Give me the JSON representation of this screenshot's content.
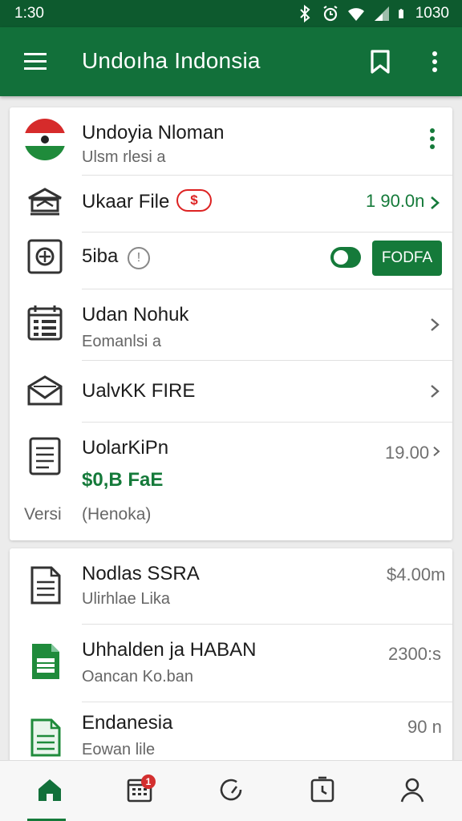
{
  "status_bar": {
    "time": "1:30",
    "clock": "1030"
  },
  "app_bar": {
    "title": "Undoıha Indonsia"
  },
  "card1": {
    "profile": {
      "title": "Undoyia Nloman",
      "subtitle": "Ulsm rlesi a"
    },
    "row_file": {
      "label": "Ukaar File",
      "badge": "$",
      "value": "1 90.0n"
    },
    "row_toggle": {
      "label": "5iba",
      "info": "!",
      "button": "FODFA"
    },
    "row_calendar": {
      "title": "Udan Nohuk",
      "subtitle": "Eomanlsi a"
    },
    "row_mail": {
      "label": "UalvKK FIRE"
    },
    "row_doc": {
      "title": "UolarKiPn",
      "amount": "$0,B FaE",
      "value": "19.00",
      "version_label": "Versi",
      "version_value": "(Henoka)"
    }
  },
  "card2": {
    "items": [
      {
        "title": "Nodlas SSRA",
        "subtitle": "Ulirhlae Lika",
        "value": "$4.00m"
      },
      {
        "title": "Uhhalden ja HABAN",
        "subtitle": "Oancan Ko.ban",
        "value": "2300:s"
      },
      {
        "title": "Endanesia",
        "subtitle": "Eowan lile",
        "value": "90 n"
      }
    ]
  },
  "bottom_nav": {
    "items": [
      "home-icon",
      "calendar-icon",
      "refresh-icon",
      "timer-icon",
      "profile-icon"
    ],
    "badge": "1"
  },
  "colors": {
    "primary": "#12703a",
    "status": "#0d5a2e",
    "accent_red": "#d22"
  }
}
